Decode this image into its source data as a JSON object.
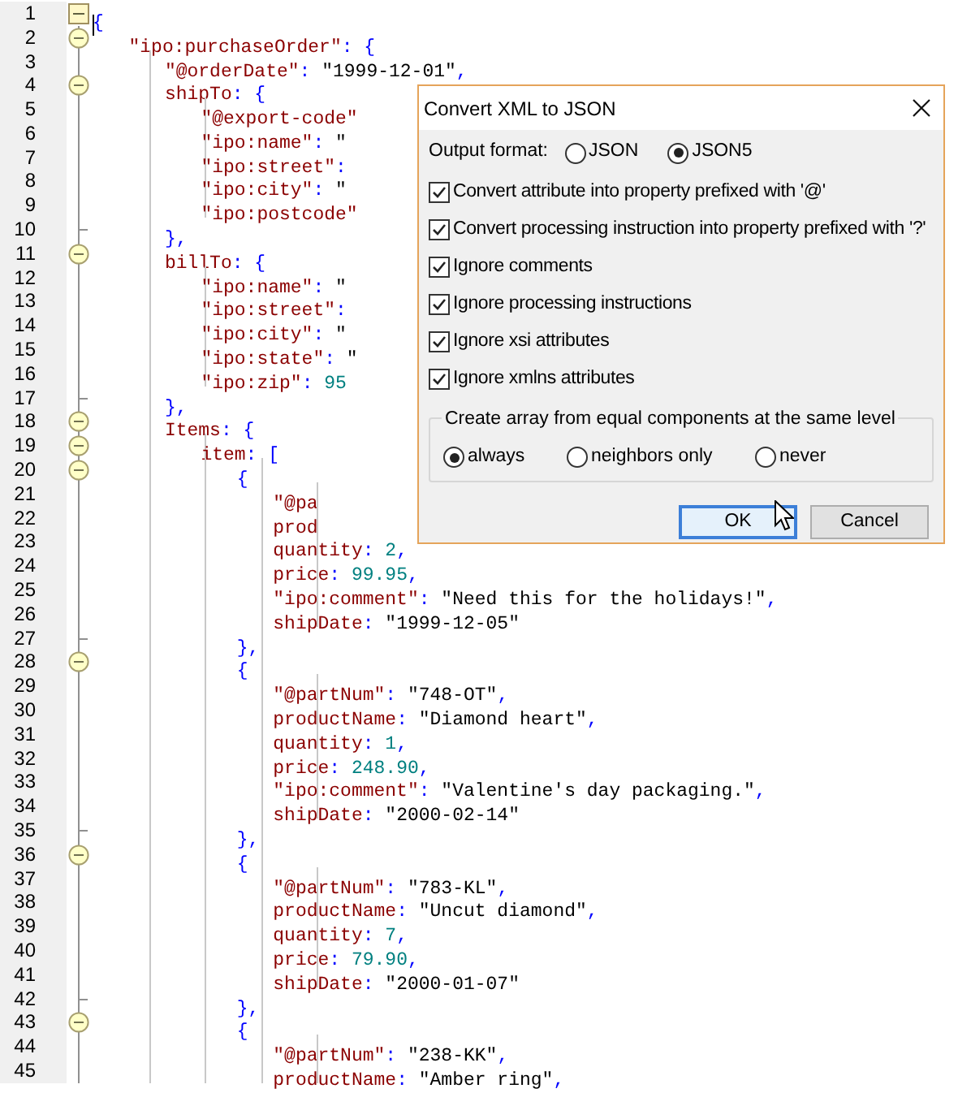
{
  "editor": {
    "lines": [
      {
        "number": "1",
        "kind": "root",
        "caret": true,
        "tokens": [
          {
            "kind": "punct",
            "text": "{"
          }
        ]
      },
      {
        "number": "2",
        "kind": "opener",
        "tokens": [
          {
            "kind": "key",
            "text": "\t\"ipo:purchaseOrder\""
          },
          {
            "kind": "punct",
            "text": ": {"
          }
        ]
      },
      {
        "number": "3",
        "kind": "plain",
        "tokens": [
          {
            "kind": "key",
            "text": "\t\t\"@orderDate\""
          },
          {
            "kind": "punct",
            "text": ": "
          },
          {
            "kind": "string",
            "text": "\"1999-12-01\""
          },
          {
            "kind": "punct",
            "text": ","
          }
        ]
      },
      {
        "number": "4",
        "kind": "opener",
        "tokens": [
          {
            "kind": "key",
            "text": "\t\tshipTo"
          },
          {
            "kind": "punct",
            "text": ": {"
          }
        ]
      },
      {
        "number": "5",
        "kind": "plain",
        "tokens": [
          {
            "kind": "key",
            "text": "\t\t\t\"@export-code\""
          }
        ]
      },
      {
        "number": "6",
        "kind": "plain",
        "tokens": [
          {
            "kind": "key",
            "text": "\t\t\t\"ipo:name\""
          },
          {
            "kind": "punct",
            "text": ": "
          },
          {
            "kind": "string",
            "text": "\""
          }
        ]
      },
      {
        "number": "7",
        "kind": "plain",
        "tokens": [
          {
            "kind": "key",
            "text": "\t\t\t\"ipo:street\""
          },
          {
            "kind": "punct",
            "text": ":"
          }
        ]
      },
      {
        "number": "8",
        "kind": "plain",
        "tokens": [
          {
            "kind": "key",
            "text": "\t\t\t\"ipo:city\""
          },
          {
            "kind": "punct",
            "text": ": "
          },
          {
            "kind": "string",
            "text": "\""
          }
        ]
      },
      {
        "number": "9",
        "kind": "plain",
        "tokens": [
          {
            "kind": "key",
            "text": "\t\t\t\"ipo:postcode\""
          }
        ]
      },
      {
        "number": "10",
        "kind": "closer",
        "tokens": [
          {
            "kind": "punct",
            "text": "\t\t},"
          }
        ]
      },
      {
        "number": "11",
        "kind": "opener",
        "tokens": [
          {
            "kind": "key",
            "text": "\t\tbillTo"
          },
          {
            "kind": "punct",
            "text": ": {"
          }
        ]
      },
      {
        "number": "12",
        "kind": "plain",
        "tokens": [
          {
            "kind": "key",
            "text": "\t\t\t\"ipo:name\""
          },
          {
            "kind": "punct",
            "text": ": "
          },
          {
            "kind": "string",
            "text": "\""
          }
        ]
      },
      {
        "number": "13",
        "kind": "plain",
        "tokens": [
          {
            "kind": "key",
            "text": "\t\t\t\"ipo:street\""
          },
          {
            "kind": "punct",
            "text": ":"
          }
        ]
      },
      {
        "number": "14",
        "kind": "plain",
        "tokens": [
          {
            "kind": "key",
            "text": "\t\t\t\"ipo:city\""
          },
          {
            "kind": "punct",
            "text": ": "
          },
          {
            "kind": "string",
            "text": "\""
          }
        ]
      },
      {
        "number": "15",
        "kind": "plain",
        "tokens": [
          {
            "kind": "key",
            "text": "\t\t\t\"ipo:state\""
          },
          {
            "kind": "punct",
            "text": ": "
          },
          {
            "kind": "string",
            "text": "\""
          }
        ]
      },
      {
        "number": "16",
        "kind": "plain",
        "tokens": [
          {
            "kind": "key",
            "text": "\t\t\t\"ipo:zip\""
          },
          {
            "kind": "punct",
            "text": ": "
          },
          {
            "kind": "number",
            "text": "95"
          }
        ]
      },
      {
        "number": "17",
        "kind": "closer",
        "tokens": [
          {
            "kind": "punct",
            "text": "\t\t},"
          }
        ]
      },
      {
        "number": "18",
        "kind": "opener",
        "tokens": [
          {
            "kind": "key",
            "text": "\t\tItems"
          },
          {
            "kind": "punct",
            "text": ": {"
          }
        ]
      },
      {
        "number": "19",
        "kind": "opener",
        "tokens": [
          {
            "kind": "key",
            "text": "\t\t\titem"
          },
          {
            "kind": "punct",
            "text": ": ["
          }
        ]
      },
      {
        "number": "20",
        "kind": "opener",
        "tokens": [
          {
            "kind": "punct",
            "text": "\t\t\t\t{"
          }
        ]
      },
      {
        "number": "21",
        "kind": "plain",
        "tokens": [
          {
            "kind": "key",
            "text": "\t\t\t\t\t\"@pa"
          }
        ]
      },
      {
        "number": "22",
        "kind": "plain",
        "tokens": [
          {
            "kind": "key",
            "text": "\t\t\t\t\tprod"
          }
        ]
      },
      {
        "number": "23",
        "kind": "plain",
        "tokens": [
          {
            "kind": "key",
            "text": "\t\t\t\t\tquantity"
          },
          {
            "kind": "punct",
            "text": ": "
          },
          {
            "kind": "number",
            "text": "2"
          },
          {
            "kind": "punct",
            "text": ","
          }
        ]
      },
      {
        "number": "24",
        "kind": "plain",
        "tokens": [
          {
            "kind": "key",
            "text": "\t\t\t\t\tprice"
          },
          {
            "kind": "punct",
            "text": ": "
          },
          {
            "kind": "number",
            "text": "99.95"
          },
          {
            "kind": "punct",
            "text": ","
          }
        ]
      },
      {
        "number": "25",
        "kind": "plain",
        "tokens": [
          {
            "kind": "key",
            "text": "\t\t\t\t\t\"ipo:comment\""
          },
          {
            "kind": "punct",
            "text": ": "
          },
          {
            "kind": "string",
            "text": "\"Need this for the holidays!\""
          },
          {
            "kind": "punct",
            "text": ","
          }
        ]
      },
      {
        "number": "26",
        "kind": "plain",
        "tokens": [
          {
            "kind": "key",
            "text": "\t\t\t\t\tshipDate"
          },
          {
            "kind": "punct",
            "text": ": "
          },
          {
            "kind": "string",
            "text": "\"1999-12-05\""
          }
        ]
      },
      {
        "number": "27",
        "kind": "closer",
        "tokens": [
          {
            "kind": "punct",
            "text": "\t\t\t\t},"
          }
        ]
      },
      {
        "number": "28",
        "kind": "opener",
        "tokens": [
          {
            "kind": "punct",
            "text": "\t\t\t\t{"
          }
        ]
      },
      {
        "number": "29",
        "kind": "plain",
        "tokens": [
          {
            "kind": "key",
            "text": "\t\t\t\t\t\"@partNum\""
          },
          {
            "kind": "punct",
            "text": ": "
          },
          {
            "kind": "string",
            "text": "\"748-OT\""
          },
          {
            "kind": "punct",
            "text": ","
          }
        ]
      },
      {
        "number": "30",
        "kind": "plain",
        "tokens": [
          {
            "kind": "key",
            "text": "\t\t\t\t\tproductName"
          },
          {
            "kind": "punct",
            "text": ": "
          },
          {
            "kind": "string",
            "text": "\"Diamond heart\""
          },
          {
            "kind": "punct",
            "text": ","
          }
        ]
      },
      {
        "number": "31",
        "kind": "plain",
        "tokens": [
          {
            "kind": "key",
            "text": "\t\t\t\t\tquantity"
          },
          {
            "kind": "punct",
            "text": ": "
          },
          {
            "kind": "number",
            "text": "1"
          },
          {
            "kind": "punct",
            "text": ","
          }
        ]
      },
      {
        "number": "32",
        "kind": "plain",
        "tokens": [
          {
            "kind": "key",
            "text": "\t\t\t\t\tprice"
          },
          {
            "kind": "punct",
            "text": ": "
          },
          {
            "kind": "number",
            "text": "248.90"
          },
          {
            "kind": "punct",
            "text": ","
          }
        ]
      },
      {
        "number": "33",
        "kind": "plain",
        "tokens": [
          {
            "kind": "key",
            "text": "\t\t\t\t\t\"ipo:comment\""
          },
          {
            "kind": "punct",
            "text": ": "
          },
          {
            "kind": "string",
            "text": "\"Valentine's day packaging.\""
          },
          {
            "kind": "punct",
            "text": ","
          }
        ]
      },
      {
        "number": "34",
        "kind": "plain",
        "tokens": [
          {
            "kind": "key",
            "text": "\t\t\t\t\tshipDate"
          },
          {
            "kind": "punct",
            "text": ": "
          },
          {
            "kind": "string",
            "text": "\"2000-02-14\""
          }
        ]
      },
      {
        "number": "35",
        "kind": "closer",
        "tokens": [
          {
            "kind": "punct",
            "text": "\t\t\t\t},"
          }
        ]
      },
      {
        "number": "36",
        "kind": "opener",
        "tokens": [
          {
            "kind": "punct",
            "text": "\t\t\t\t{"
          }
        ]
      },
      {
        "number": "37",
        "kind": "plain",
        "tokens": [
          {
            "kind": "key",
            "text": "\t\t\t\t\t\"@partNum\""
          },
          {
            "kind": "punct",
            "text": ": "
          },
          {
            "kind": "string",
            "text": "\"783-KL\""
          },
          {
            "kind": "punct",
            "text": ","
          }
        ]
      },
      {
        "number": "38",
        "kind": "plain",
        "tokens": [
          {
            "kind": "key",
            "text": "\t\t\t\t\tproductName"
          },
          {
            "kind": "punct",
            "text": ": "
          },
          {
            "kind": "string",
            "text": "\"Uncut diamond\""
          },
          {
            "kind": "punct",
            "text": ","
          }
        ]
      },
      {
        "number": "39",
        "kind": "plain",
        "tokens": [
          {
            "kind": "key",
            "text": "\t\t\t\t\tquantity"
          },
          {
            "kind": "punct",
            "text": ": "
          },
          {
            "kind": "number",
            "text": "7"
          },
          {
            "kind": "punct",
            "text": ","
          }
        ]
      },
      {
        "number": "40",
        "kind": "plain",
        "tokens": [
          {
            "kind": "key",
            "text": "\t\t\t\t\tprice"
          },
          {
            "kind": "punct",
            "text": ": "
          },
          {
            "kind": "number",
            "text": "79.90"
          },
          {
            "kind": "punct",
            "text": ","
          }
        ]
      },
      {
        "number": "41",
        "kind": "plain",
        "tokens": [
          {
            "kind": "key",
            "text": "\t\t\t\t\tshipDate"
          },
          {
            "kind": "punct",
            "text": ": "
          },
          {
            "kind": "string",
            "text": "\"2000-01-07\""
          }
        ]
      },
      {
        "number": "42",
        "kind": "closer",
        "tokens": [
          {
            "kind": "punct",
            "text": "\t\t\t\t},"
          }
        ]
      },
      {
        "number": "43",
        "kind": "opener",
        "tokens": [
          {
            "kind": "punct",
            "text": "\t\t\t\t{"
          }
        ]
      },
      {
        "number": "44",
        "kind": "plain",
        "tokens": [
          {
            "kind": "key",
            "text": "\t\t\t\t\t\"@partNum\""
          },
          {
            "kind": "punct",
            "text": ": "
          },
          {
            "kind": "string",
            "text": "\"238-KK\""
          },
          {
            "kind": "punct",
            "text": ","
          }
        ]
      },
      {
        "number": "45",
        "kind": "plain",
        "tokens": [
          {
            "kind": "key",
            "text": "\t\t\t\t\tproductName"
          },
          {
            "kind": "punct",
            "text": ": "
          },
          {
            "kind": "string",
            "text": "\"Amber ring\""
          },
          {
            "kind": "punct",
            "text": ","
          }
        ]
      }
    ]
  },
  "dialog": {
    "title": "Convert XML to JSON",
    "output_format": {
      "label": "Output format:",
      "options": [
        {
          "label": "JSON",
          "selected": false
        },
        {
          "label": "JSON5",
          "selected": true
        }
      ]
    },
    "options": [
      {
        "label": "Convert attribute into property prefixed with '@'",
        "checked": true
      },
      {
        "label": "Convert processing instruction into property prefixed with '?'",
        "checked": true
      },
      {
        "label": "Ignore comments",
        "checked": true
      },
      {
        "label": "Ignore processing instructions",
        "checked": true
      },
      {
        "label": "Ignore xsi attributes",
        "checked": true
      },
      {
        "label": "Ignore xmlns attributes",
        "checked": true
      }
    ],
    "array_group": {
      "label": "Create array from equal components at the same level",
      "options": [
        {
          "label": "always",
          "selected": true
        },
        {
          "label": "neighbors only",
          "selected": false
        },
        {
          "label": "never",
          "selected": false
        }
      ]
    },
    "buttons": [
      {
        "label": "OK",
        "focused": true
      },
      {
        "label": "Cancel",
        "focused": false
      }
    ]
  }
}
